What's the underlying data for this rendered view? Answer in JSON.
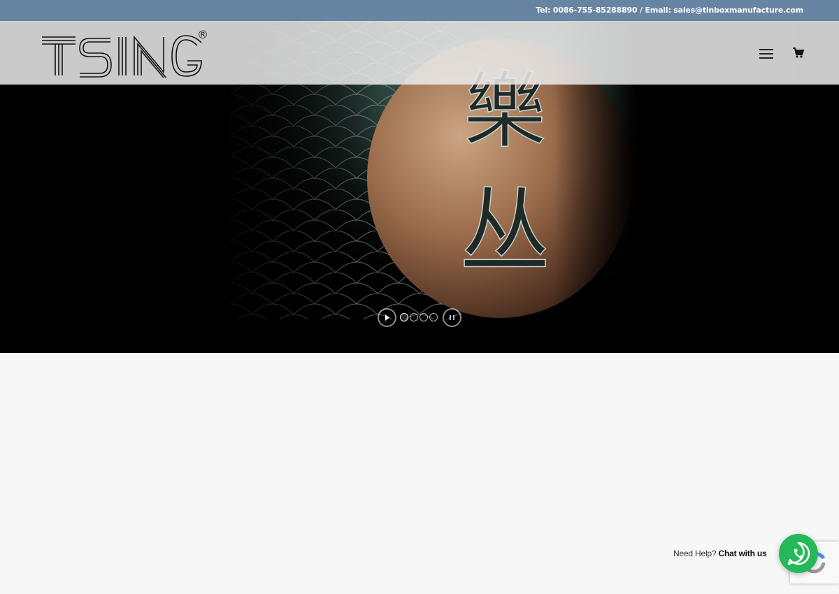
{
  "topbar": {
    "contact": "Tel: 0086-755-85288890 / Email: sales@tinboxmanufacture.com"
  },
  "header": {
    "logo_text": "TSING",
    "logo_mark": "®",
    "menu_icon": "hamburger-menu-icon",
    "cart_icon": "shopping-cart-icon"
  },
  "hero": {
    "kanji_top": "樂",
    "kanji_bottom": "丛",
    "slider": {
      "play_icon": "play-icon",
      "pause_icon": "pause-icon",
      "dots": 4,
      "active_dot": 1
    }
  },
  "chat": {
    "prefix": "Need Help?",
    "cta": "Chat with us",
    "icon": "whatsapp-icon"
  },
  "colors": {
    "topbar": "#6784a3",
    "whatsapp": "#25b858",
    "page_bg": "#f7f7f7"
  }
}
